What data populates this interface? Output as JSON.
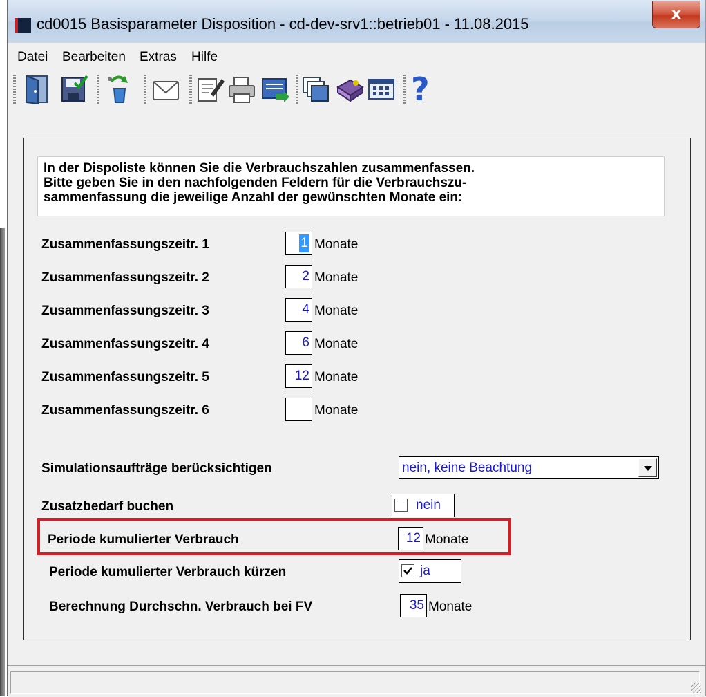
{
  "window": {
    "title": "cd0015 Basisparameter Disposition - cd-dev-srv1::betrieb01 - 11.08.2015",
    "close_label": "x"
  },
  "menu": [
    {
      "label": "Datei"
    },
    {
      "label": "Bearbeiten"
    },
    {
      "label": "Extras"
    },
    {
      "label": "Hilfe"
    }
  ],
  "toolbar": {
    "icons": [
      "exit-door-icon",
      "save-icon",
      "recycle-icon",
      "mail-icon",
      "edit-document-icon",
      "print-icon",
      "transfer-icon",
      "windows-icon",
      "book-icon",
      "table-icon",
      "help-icon"
    ],
    "help_glyph": "?"
  },
  "info": {
    "lines": [
      "In der Dispoliste können Sie die Verbrauchszahlen zusammenfassen.",
      "Bitte geben Sie in den nachfolgenden Feldern für die Verbrauchszu-",
      "sammenfassung die jeweilige Anzahl der gewünschten Monate ein:"
    ]
  },
  "periods": [
    {
      "label": "Zusammenfassungszeitr. 1",
      "value": "1",
      "unit": "Monate"
    },
    {
      "label": "Zusammenfassungszeitr. 2",
      "value": "2",
      "unit": "Monate"
    },
    {
      "label": "Zusammenfassungszeitr. 3",
      "value": "4",
      "unit": "Monate"
    },
    {
      "label": "Zusammenfassungszeitr. 4",
      "value": "6",
      "unit": "Monate"
    },
    {
      "label": "Zusammenfassungszeitr. 5",
      "value": "12",
      "unit": "Monate"
    },
    {
      "label": "Zusammenfassungszeitr. 6",
      "value": "",
      "unit": "Monate"
    }
  ],
  "simulation": {
    "label": "Simulationsaufträge berücksichtigen",
    "value": "nein, keine Beachtung"
  },
  "zusatzbedarf": {
    "label": "Zusatzbedarf buchen",
    "checked": false,
    "value": "nein"
  },
  "periode_kum": {
    "label": "Periode kumulierter Verbrauch",
    "value": "12",
    "unit": "Monate"
  },
  "periode_kuerzen": {
    "label": "Periode kumulierter Verbrauch kürzen",
    "checked": true,
    "value": "ja"
  },
  "durchschnitt": {
    "label": "Berechnung Durchschn. Verbrauch bei FV",
    "value": "35",
    "unit": "Monate"
  },
  "colors": {
    "field_text": "#1a1ac8",
    "highlight": "#d11f28",
    "selection": "#3399ff"
  }
}
